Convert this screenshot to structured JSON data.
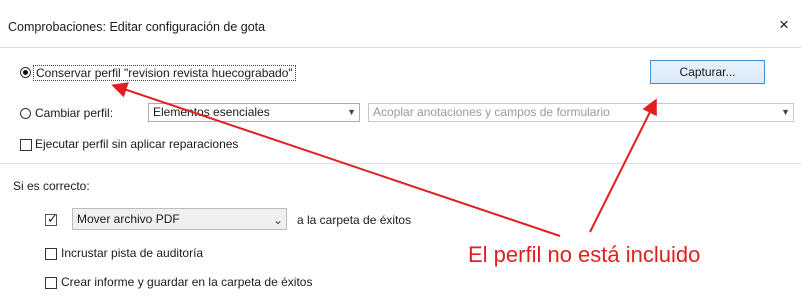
{
  "dialog": {
    "title": "Comprobaciones: Editar configuración de gota",
    "close_glyph": "×"
  },
  "options": {
    "keep_profile_label": "Conservar perfil \"revision revista huecograbado\"",
    "capture_button": "Capturar...",
    "change_profile_label": "Cambiar perfil:",
    "profile_category": "Elementos esenciales",
    "profile_name": "Acoplar anotaciones y campos de formulario",
    "run_without_fix_label": "Ejecutar perfil sin aplicar reparaciones"
  },
  "success": {
    "heading": "Si es correcto:",
    "move_action": "Mover archivo PDF",
    "move_suffix": "a la carpeta de éxitos",
    "audit_trail_label": "Incrustar pista de auditoría",
    "report_label": "Crear informe y guardar en la carpeta de éxitos"
  },
  "annotation": {
    "text": "El perfil no está incluido",
    "color": "#e02020"
  },
  "icons": {
    "close": "close-icon",
    "dropdown": "chevron-down-icon",
    "check": "checkmark-icon"
  }
}
